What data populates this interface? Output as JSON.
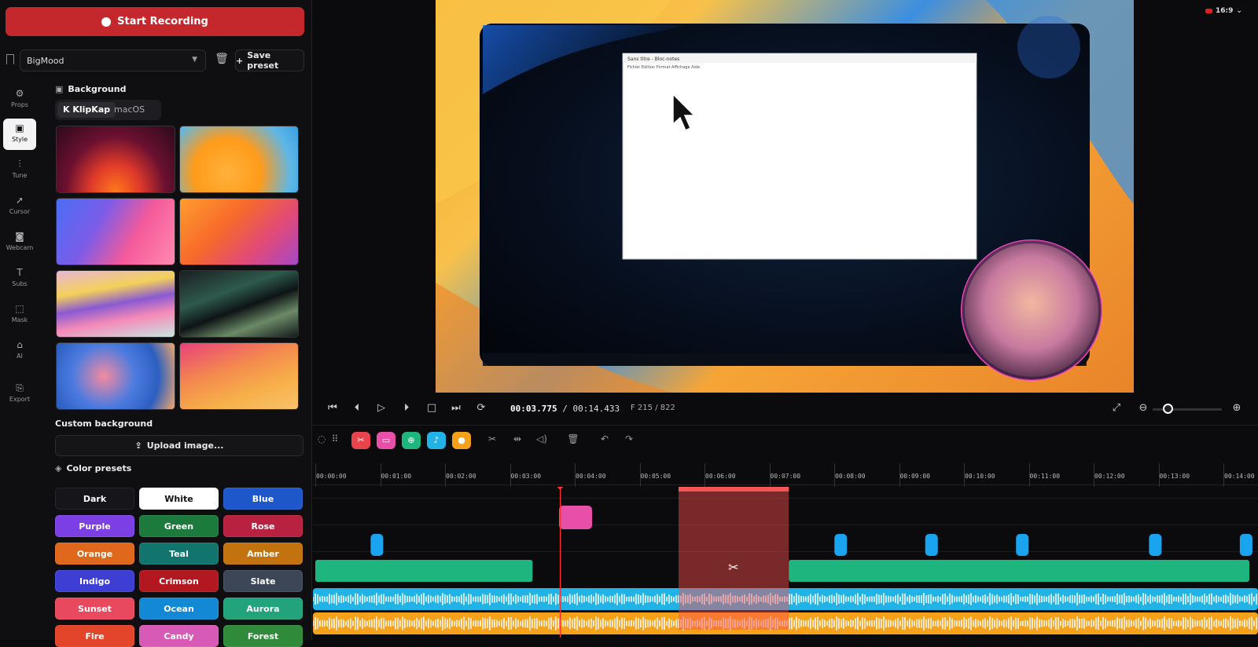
{
  "sidebar": {
    "record_label": "Start Recording",
    "preset_name": "BigMood",
    "save_preset_label": "Save preset",
    "rail": [
      {
        "label": "Props",
        "icon": "gear-icon"
      },
      {
        "label": "Style",
        "icon": "image-icon"
      },
      {
        "label": "Tune",
        "icon": "sliders-icon"
      },
      {
        "label": "Cursor",
        "icon": "cursor-icon"
      },
      {
        "label": "Webcam",
        "icon": "camera-icon"
      },
      {
        "label": "Subs",
        "icon": "text-icon"
      },
      {
        "label": "Mask",
        "icon": "mask-icon"
      },
      {
        "label": "AI",
        "icon": "robot-icon"
      },
      {
        "label": "Export",
        "icon": "export-icon"
      }
    ],
    "active_rail": "Style"
  },
  "style": {
    "background_title": "Background",
    "tabs": [
      "KlipKap",
      "macOS"
    ],
    "active_tab": "KlipKap",
    "custom_background_title": "Custom background",
    "upload_label": "Upload image...",
    "color_presets_title": "Color presets",
    "color_presets": [
      {
        "label": "Dark",
        "color": "#15151a",
        "text": "#ffffff"
      },
      {
        "label": "White",
        "color": "#ffffff",
        "text": "#111111"
      },
      {
        "label": "Blue",
        "color": "#1e57c9",
        "text": "#ffffff"
      },
      {
        "label": "Purple",
        "color": "#7b3fe4",
        "text": "#ffffff"
      },
      {
        "label": "Green",
        "color": "#1c7a3d",
        "text": "#ffffff"
      },
      {
        "label": "Rose",
        "color": "#b8213f",
        "text": "#ffffff"
      },
      {
        "label": "Orange",
        "color": "#e0681d",
        "text": "#ffffff"
      },
      {
        "label": "Teal",
        "color": "#11756e",
        "text": "#ffffff"
      },
      {
        "label": "Amber",
        "color": "#c2730f",
        "text": "#ffffff"
      },
      {
        "label": "Indigo",
        "color": "#3d3fd4",
        "text": "#ffffff"
      },
      {
        "label": "Crimson",
        "color": "#b3171f",
        "text": "#ffffff"
      },
      {
        "label": "Slate",
        "color": "#3c4656",
        "text": "#ffffff"
      },
      {
        "label": "Sunset",
        "color": "#e8495f",
        "text": "#ffffff"
      },
      {
        "label": "Ocean",
        "color": "#1389d6",
        "text": "#ffffff"
      },
      {
        "label": "Aurora",
        "color": "#22a37c",
        "text": "#ffffff"
      },
      {
        "label": "Fire",
        "color": "#e2452a",
        "text": "#ffffff"
      },
      {
        "label": "Candy",
        "color": "#d65ab6",
        "text": "#ffffff"
      },
      {
        "label": "Forest",
        "color": "#2f8a3a",
        "text": "#ffffff"
      }
    ]
  },
  "preview": {
    "aspect_ratio": "16:9",
    "notepad_title": "Sans titre - Bloc-notes",
    "notepad_menu": "Fichier  Edition  Format  Affichage  Aide"
  },
  "transport": {
    "current_time": "00:03.775",
    "separator": " / ",
    "total_time": "00:14.433",
    "frame": "F 215 / 822",
    "zoom_level": 0.1
  },
  "timeline": {
    "ticks": [
      "00:00:00",
      "00:01:00",
      "00:02:00",
      "00:03:00",
      "00:04:00",
      "00:05:00",
      "00:06:00",
      "00:07:00",
      "00:08:00",
      "00:09:00",
      "00:10:00",
      "00:11:00",
      "00:12:00",
      "00:13:00",
      "00:14:00"
    ],
    "playhead_time": "00:03.775",
    "selection": {
      "start_s": 5.6,
      "end_s": 7.3
    },
    "zoom_clips": [
      {
        "start_s": 0.0,
        "end_s": 3.35
      },
      {
        "start_s": 7.3,
        "end_s": 14.4
      }
    ],
    "webcam_marker_s": 4.0,
    "blue_markers_s": [
      0.95,
      8.1,
      9.5,
      10.9,
      12.95,
      14.35
    ]
  },
  "colors": {
    "accent_red": "#c4282d",
    "zoom_green": "#1fb57f",
    "audio_blue": "#22b3e6",
    "audio_orange": "#f5a11a",
    "marker_blue": "#1aa4f0",
    "webcam_pink": "#e84fa8"
  }
}
